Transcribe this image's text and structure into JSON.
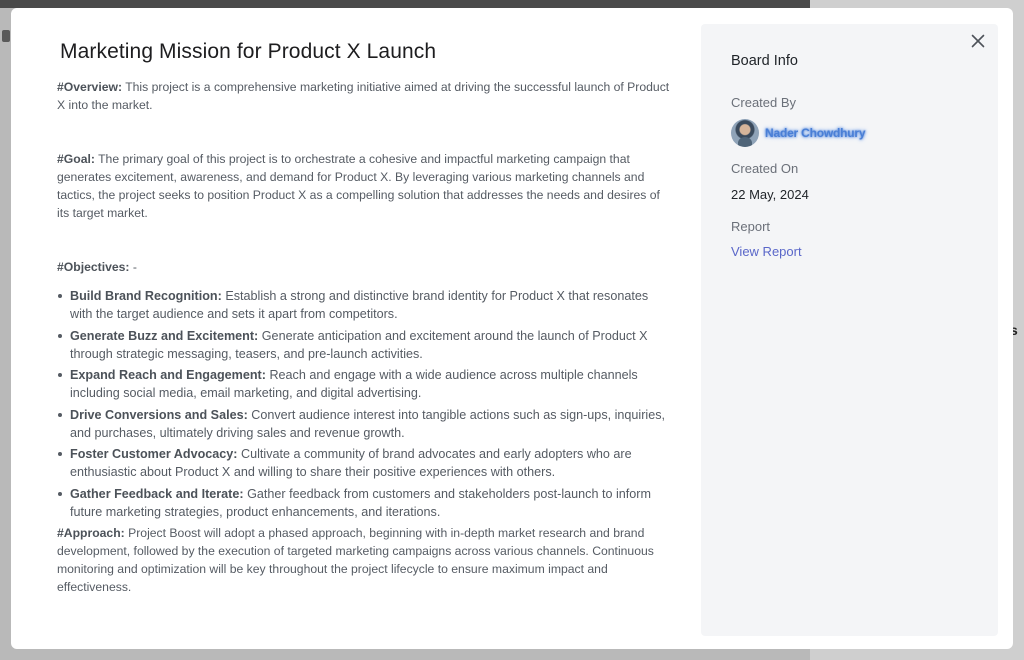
{
  "modal": {
    "title": "Marketing Mission for Product X Launch",
    "overview": {
      "label": "#Overview:",
      "text": " This project is a comprehensive marketing initiative aimed at driving the successful launch of Product X into the market."
    },
    "goal": {
      "label": "#Goal:",
      "text": " The primary goal of this project is to orchestrate a cohesive and impactful marketing campaign that generates excitement, awareness, and demand for Product X. By leveraging various marketing channels and tactics, the project seeks to position Product X as a compelling solution that addresses the needs and desires of its target market."
    },
    "objectives": {
      "label": "#Objectives:",
      "suffix": " -",
      "items": [
        {
          "title": "Build Brand Recognition:",
          "text": " Establish a strong and distinctive brand identity for Product X that resonates with the target audience and sets it apart from competitors."
        },
        {
          "title": "Generate Buzz and Excitement:",
          "text": " Generate anticipation and excitement around the launch of Product X through strategic messaging, teasers, and pre-launch activities."
        },
        {
          "title": "Expand Reach and Engagement:",
          "text": " Reach and engage with a wide audience across multiple channels including social media, email marketing, and digital advertising."
        },
        {
          "title": "Drive Conversions and Sales:",
          "text": " Convert audience interest into tangible actions such as sign-ups, inquiries, and purchases, ultimately driving sales and revenue growth."
        },
        {
          "title": "Foster Customer Advocacy:",
          "text": " Cultivate a community of brand advocates and early adopters who are enthusiastic about Product X and willing to share their positive experiences with others."
        },
        {
          "title": "Gather Feedback and Iterate:",
          "text": " Gather feedback from customers and stakeholders post-launch to inform future marketing strategies, product enhancements, and iterations."
        }
      ]
    },
    "approach": {
      "label": "#Approach:",
      "text": " Project Boost will adopt a phased approach, beginning with in-depth market research and brand development, followed by the execution of targeted marketing campaigns across various channels. Continuous monitoring and optimization will be key throughout the project lifecycle to ensure maximum impact and effectiveness."
    }
  },
  "board_info": {
    "heading": "Board Info",
    "created_by_label": "Created By",
    "creator_name": "Nader Chowdhury",
    "created_on_label": "Created On",
    "created_on_value": "22 May, 2024",
    "report_label": "Report",
    "view_report_link": "View Report"
  },
  "icons": {
    "close": "close-icon",
    "avatar": "avatar"
  },
  "colors": {
    "link": "#5a67c9",
    "sidebar_bg": "#f4f5f7",
    "body_text": "#555b63"
  }
}
